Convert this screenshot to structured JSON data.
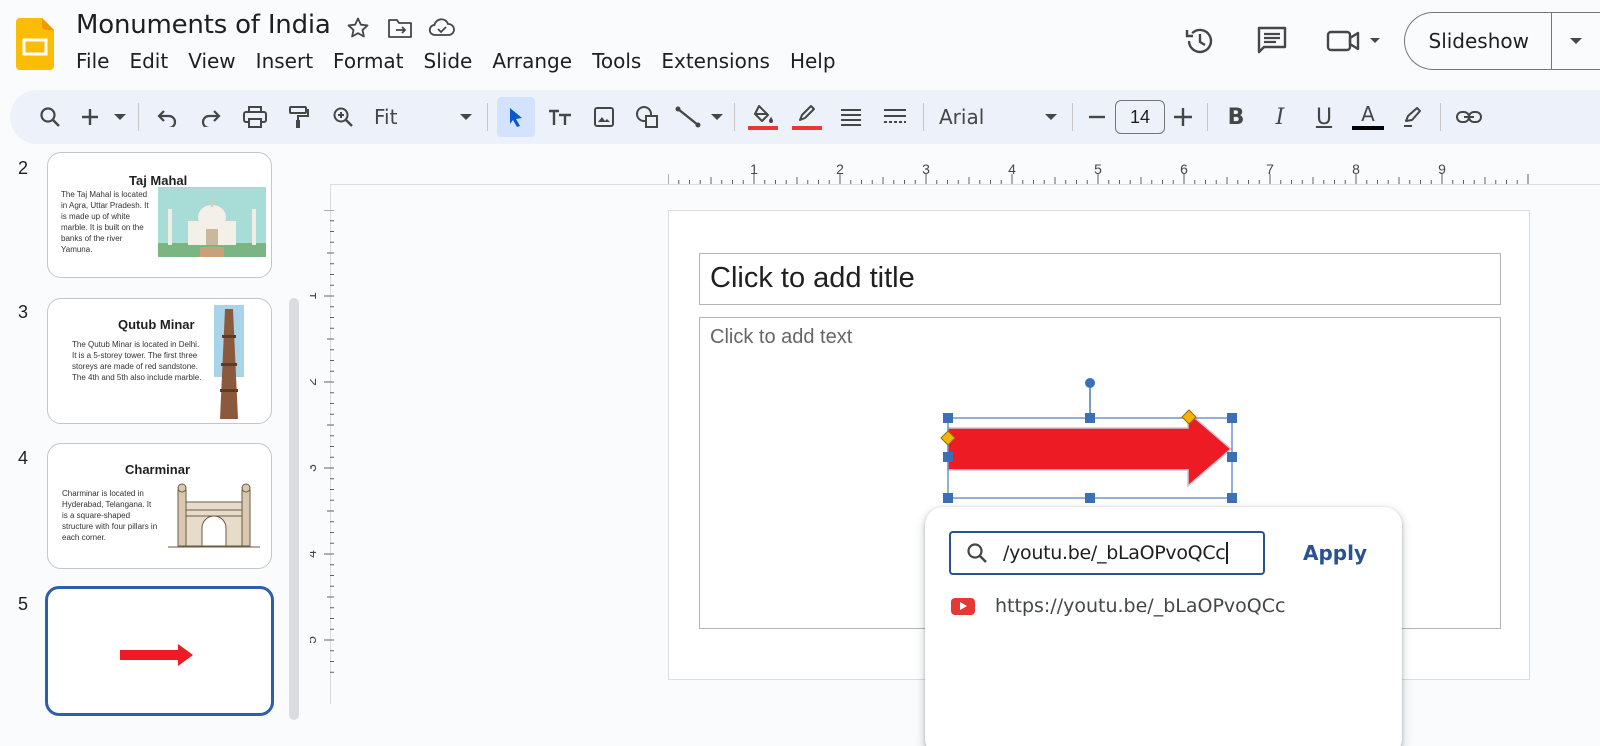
{
  "document": {
    "title": "Monuments of India"
  },
  "menu": [
    "File",
    "Edit",
    "View",
    "Insert",
    "Format",
    "Slide",
    "Arrange",
    "Tools",
    "Extensions",
    "Help"
  ],
  "header": {
    "slideshow_label": "Slideshow"
  },
  "toolbar": {
    "zoom_label": "Fit",
    "font_name": "Arial",
    "font_size": "14",
    "fill_color": "#e53935",
    "border_color": "#e53935",
    "text_color": "#000000"
  },
  "filmstrip": {
    "slides": [
      {
        "number": "2",
        "title": "Taj Mahal",
        "body": "The Taj Mahal is located in Agra, Uttar Pradesh. It is made up of white marble. It is built on the banks of the river Yamuna."
      },
      {
        "number": "3",
        "title": "Qutub Minar",
        "body": "The Qutub Minar is located in Delhi. It is a 5-storey tower. The first three storeys are made of red sandstone. The 4th and 5th also include marble."
      },
      {
        "number": "4",
        "title": "Charminar",
        "body": "Charminar is located in Hyderabad, Telangana. It is a square-shaped structure with four pillars in each corner."
      },
      {
        "number": "5",
        "title": "",
        "body": ""
      }
    ]
  },
  "ruler": {
    "horizontal_labels": [
      "1",
      "2",
      "3",
      "4",
      "5",
      "6",
      "7",
      "8",
      "9"
    ],
    "vertical_labels": [
      "1",
      "2",
      "3",
      "4",
      "5"
    ]
  },
  "slide": {
    "title_placeholder": "Click to add title",
    "body_placeholder": "Click to add text",
    "shape": "right-arrow",
    "shape_fill": "#ed1c24"
  },
  "link_popup": {
    "input_value": "/youtu.be/_bLaOPvoQCc",
    "apply_label": "Apply",
    "suggestion_icon": "youtube-icon",
    "suggestion_url": "https://youtu.be/_bLaOPvoQCc"
  }
}
